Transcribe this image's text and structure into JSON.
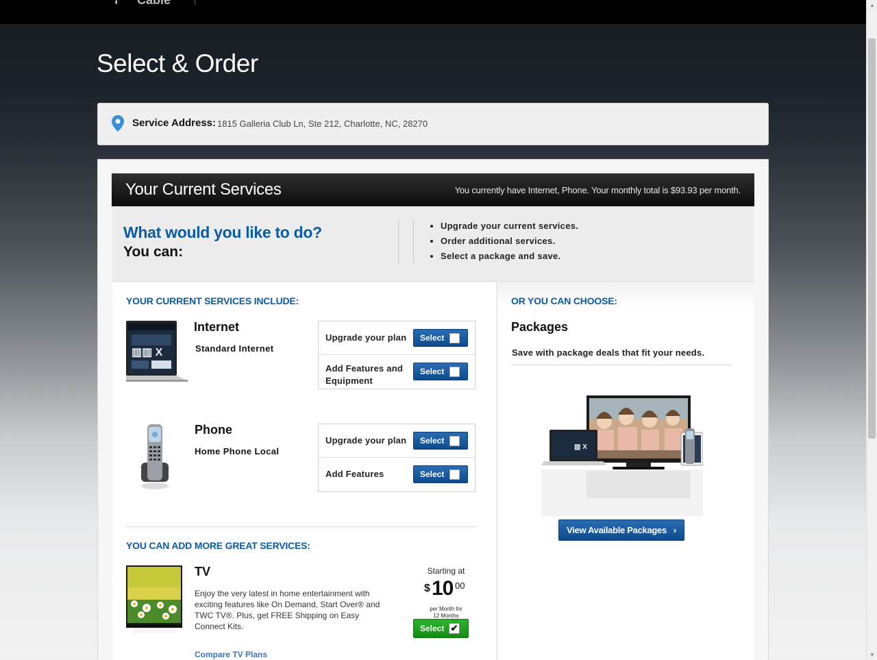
{
  "topbar": {
    "logo_text": "Cable"
  },
  "page": {
    "title": "Select & Order"
  },
  "address": {
    "label": "Service Address:",
    "value": "1815 Galleria Club Ln, Ste 212, Charlotte, NC, 28270"
  },
  "current_services": {
    "title": "Your Current Services",
    "summary": "You currently have Internet, Phone. Your monthly total is $93.93 per month."
  },
  "prompt": {
    "question": "What would you like to do?",
    "sub": "You can:",
    "bullets": [
      "Upgrade your current services.",
      "Order additional services.",
      "Select a package and save."
    ]
  },
  "left": {
    "include_label": "YOUR CURRENT SERVICES INCLUDE:",
    "services": [
      {
        "name": "Internet",
        "plan": "Standard Internet",
        "options": [
          {
            "label": "Upgrade your plan",
            "button": "Select"
          },
          {
            "label": "Add Features and Equipment",
            "button": "Select"
          }
        ]
      },
      {
        "name": "Phone",
        "plan": "Home Phone Local",
        "options": [
          {
            "label": "Upgrade your plan",
            "button": "Select"
          },
          {
            "label": "Add Features",
            "button": "Select"
          }
        ]
      }
    ],
    "add_label": "YOU CAN ADD MORE GREAT SERVICES:",
    "tv": {
      "name": "TV",
      "description": "Enjoy the very latest in home entertainment with exciting features like On Demand, Start Over® and TWC TV®. Plus, get FREE Shipping on Easy Connect Kits.",
      "link": "Compare TV Plans",
      "starting_at": "Starting at",
      "price_symbol": "$",
      "price_whole": "10",
      "price_cents": "00",
      "price_term_1": "per Month for",
      "price_term_2": "12 Months",
      "button": "Select",
      "checkmark": "✔"
    }
  },
  "right": {
    "choose_label": "OR YOU CAN CHOOSE:",
    "packages_title": "Packages",
    "packages_desc": "Save with package deals that fit your needs.",
    "button": "View Available Packages",
    "button_arrow": "›"
  },
  "colors": {
    "accent_blue": "#0b5aa2",
    "button_blue": "#1a5ca3",
    "button_green": "#1e9e1e"
  },
  "icons": [
    "location-pin-icon",
    "checkbox-icon",
    "checkmark-icon",
    "chevron-right-icon"
  ]
}
